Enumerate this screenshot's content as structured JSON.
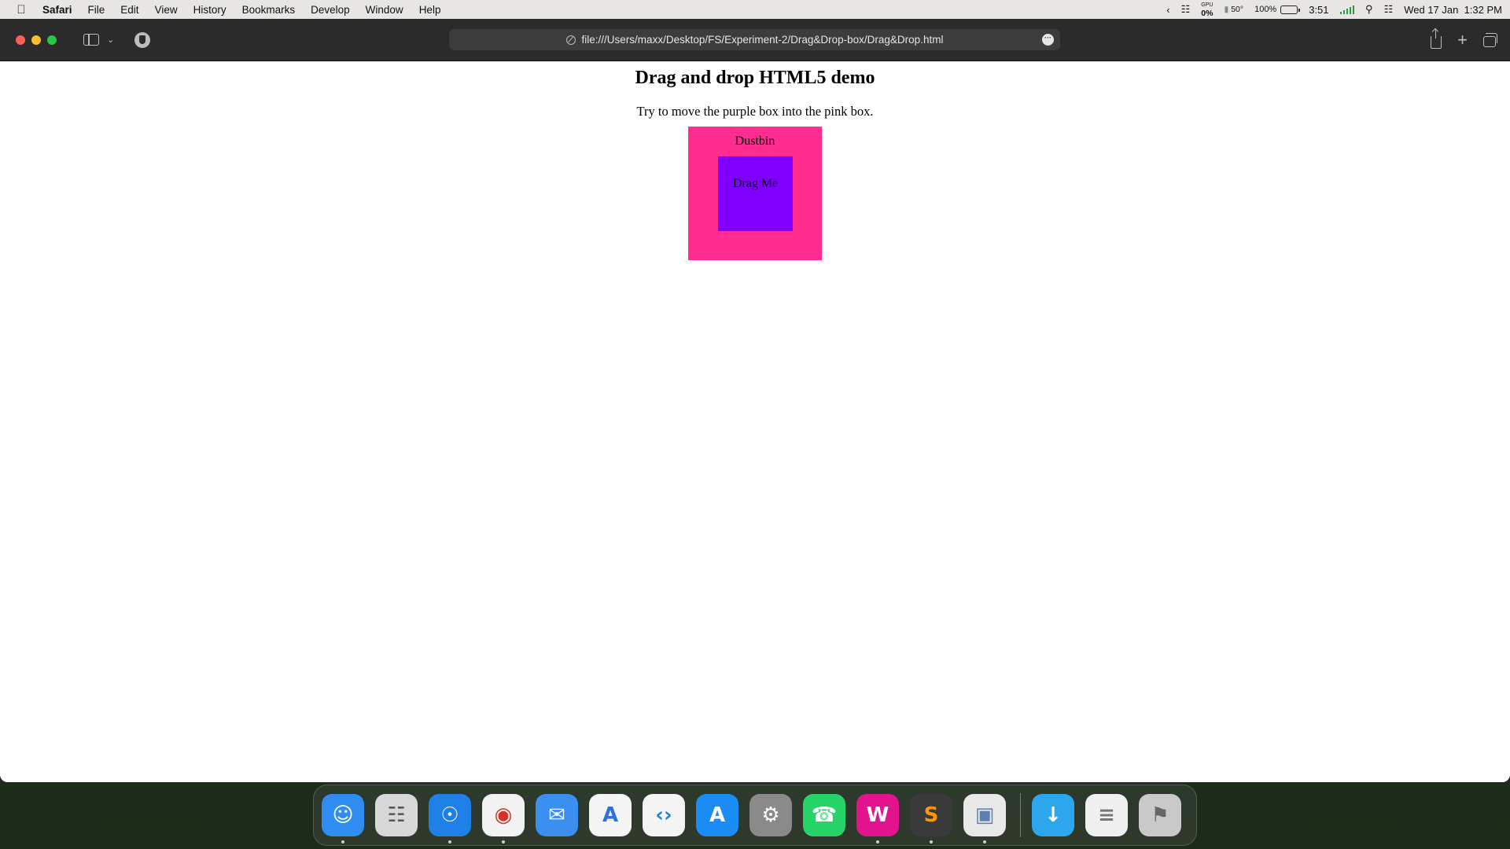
{
  "menubar": {
    "app_name": "Safari",
    "items": [
      "File",
      "Edit",
      "View",
      "History",
      "Bookmarks",
      "Develop",
      "Window",
      "Help"
    ],
    "status": {
      "gpu_label": "GPU",
      "gpu_value": "0%",
      "temperature": "50°",
      "battery_percent": "100%",
      "time_left": "3:51",
      "datetime": "Wed 17 Jan  1:32 PM"
    }
  },
  "browser": {
    "url": "file:///Users/maxx/Desktop/FS/Experiment-2/Drag&Drop-box/Drag&Drop.html"
  },
  "page": {
    "heading": "Drag and drop HTML5 demo",
    "instruction": "Try to move the purple box into the pink box.",
    "dustbin_label": "Dustbin",
    "drag_label": "Drag Me",
    "colors": {
      "dustbin": "#ff2d8f",
      "drag_box": "#8000ff"
    }
  },
  "dock": {
    "apps": [
      {
        "name": "finder-icon",
        "color": "#2f8cf0",
        "running": true
      },
      {
        "name": "launchpad-icon",
        "color": "#d8d8d8",
        "running": false
      },
      {
        "name": "safari-icon",
        "color": "#1e7fe6",
        "running": true
      },
      {
        "name": "chrome-icon",
        "color": "#f2f2f2",
        "running": true
      },
      {
        "name": "mail-icon",
        "color": "#3a8ff0",
        "running": false
      },
      {
        "name": "instruments-icon",
        "color": "#f4f4f4",
        "running": false
      },
      {
        "name": "vscode-icon",
        "color": "#f4f4f4",
        "running": false
      },
      {
        "name": "app-store-icon",
        "color": "#1a8cf5",
        "running": false
      },
      {
        "name": "system-settings-icon",
        "color": "#8a8a8a",
        "running": false
      },
      {
        "name": "whatsapp-icon",
        "color": "#25d366",
        "running": false
      },
      {
        "name": "wps-office-icon",
        "color": "#e3138f",
        "running": true
      },
      {
        "name": "sublime-text-icon",
        "color": "#3a3a3a",
        "running": true
      },
      {
        "name": "preview-icon",
        "color": "#e8e8e8",
        "running": true
      }
    ],
    "stack_apps": [
      {
        "name": "downloads-folder-icon",
        "color": "#2ca7ee"
      },
      {
        "name": "recent-document-icon",
        "color": "#f0f0f0"
      },
      {
        "name": "trash-icon",
        "color": "#c9c9c9"
      }
    ]
  }
}
